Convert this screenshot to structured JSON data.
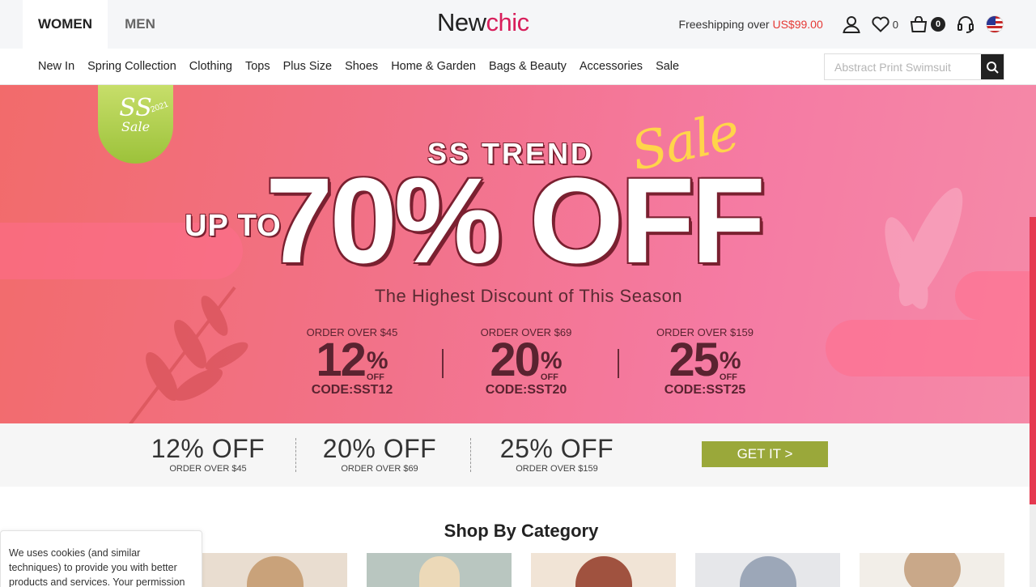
{
  "header": {
    "tabs": [
      "WOMEN",
      "MEN"
    ],
    "logo": {
      "part1": "New",
      "part2": "chic"
    },
    "shipping": {
      "label": "Freeshipping over ",
      "amount": "US$99.00"
    },
    "wishlist_count": "0",
    "cart_count": "0",
    "icons": [
      "user-icon",
      "heart-icon",
      "cart-icon",
      "headset-icon",
      "us-flag-icon",
      "search-icon"
    ]
  },
  "nav": {
    "items": [
      "New In",
      "Spring Collection",
      "Clothing",
      "Tops",
      "Plus Size",
      "Shoes",
      "Home & Garden",
      "Bags & Beauty",
      "Accessories",
      "Sale"
    ],
    "search_placeholder": "Abstract Print Swimsuit"
  },
  "hero": {
    "badge": {
      "line1": "SS",
      "line2": "Sale",
      "year": "2021"
    },
    "title": "SS TREND",
    "script": "Sale",
    "up_to": "UP TO",
    "headline": "70% OFF",
    "subtitle": "The Highest Discount of This Season",
    "tiers": [
      {
        "condition": "ORDER OVER $45",
        "value": "12",
        "pct": "%",
        "off": "OFF",
        "code": "CODE:SST12"
      },
      {
        "condition": "ORDER OVER $69",
        "value": "20",
        "pct": "%",
        "off": "OFF",
        "code": "CODE:SST20"
      },
      {
        "condition": "ORDER OVER $159",
        "value": "25",
        "pct": "%",
        "off": "OFF",
        "code": "CODE:SST25"
      }
    ]
  },
  "coupons": {
    "items": [
      {
        "title": "12% OFF",
        "sub": "ORDER OVER $45"
      },
      {
        "title": "20% OFF",
        "sub": "ORDER OVER $69"
      },
      {
        "title": "25% OFF",
        "sub": "ORDER OVER $159"
      }
    ],
    "cta": "GET IT >"
  },
  "category": {
    "title": "Shop By Category"
  },
  "cookie": {
    "text": "We uses cookies (and similar techniques) to provide you with better products and services. Your permission"
  },
  "colors": {
    "brand": "#d81e5b",
    "price": "#e53935",
    "hero_pink": "#f2728a",
    "cta_green": "#9aa83a",
    "dark": "#222222"
  }
}
